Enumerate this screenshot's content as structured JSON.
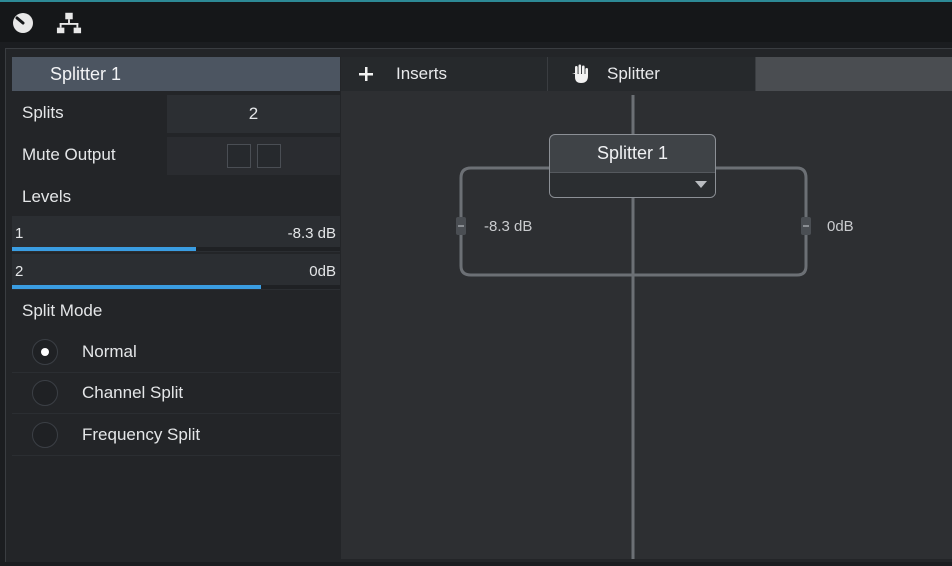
{
  "panel": {
    "title": "Splitter 1",
    "splits_label": "Splits",
    "splits_value": "2",
    "mute_label": "Mute Output",
    "levels_label": "Levels",
    "levels": [
      {
        "channel": "1",
        "db": "-8.3 dB",
        "fill_percent": 56
      },
      {
        "channel": "2",
        "db": "0dB",
        "fill_percent": 76
      }
    ],
    "split_mode_label": "Split Mode",
    "modes": [
      {
        "label": "Normal",
        "selected": true
      },
      {
        "label": "Channel Split",
        "selected": false
      },
      {
        "label": "Frequency Split",
        "selected": false
      }
    ]
  },
  "tabs": {
    "inserts_label": "Inserts",
    "splitter_label": "Splitter"
  },
  "canvas": {
    "node_title": "Splitter 1",
    "left_level": "-8.3 dB",
    "right_level": "0dB"
  },
  "icons": {
    "top_left": "gauge-icon",
    "top_second": "routing-icon",
    "inserts": "plus-icon",
    "splitter": "hand-icon"
  },
  "colors": {
    "accent": "#3a9de2",
    "title_bar": "#4c5561"
  }
}
